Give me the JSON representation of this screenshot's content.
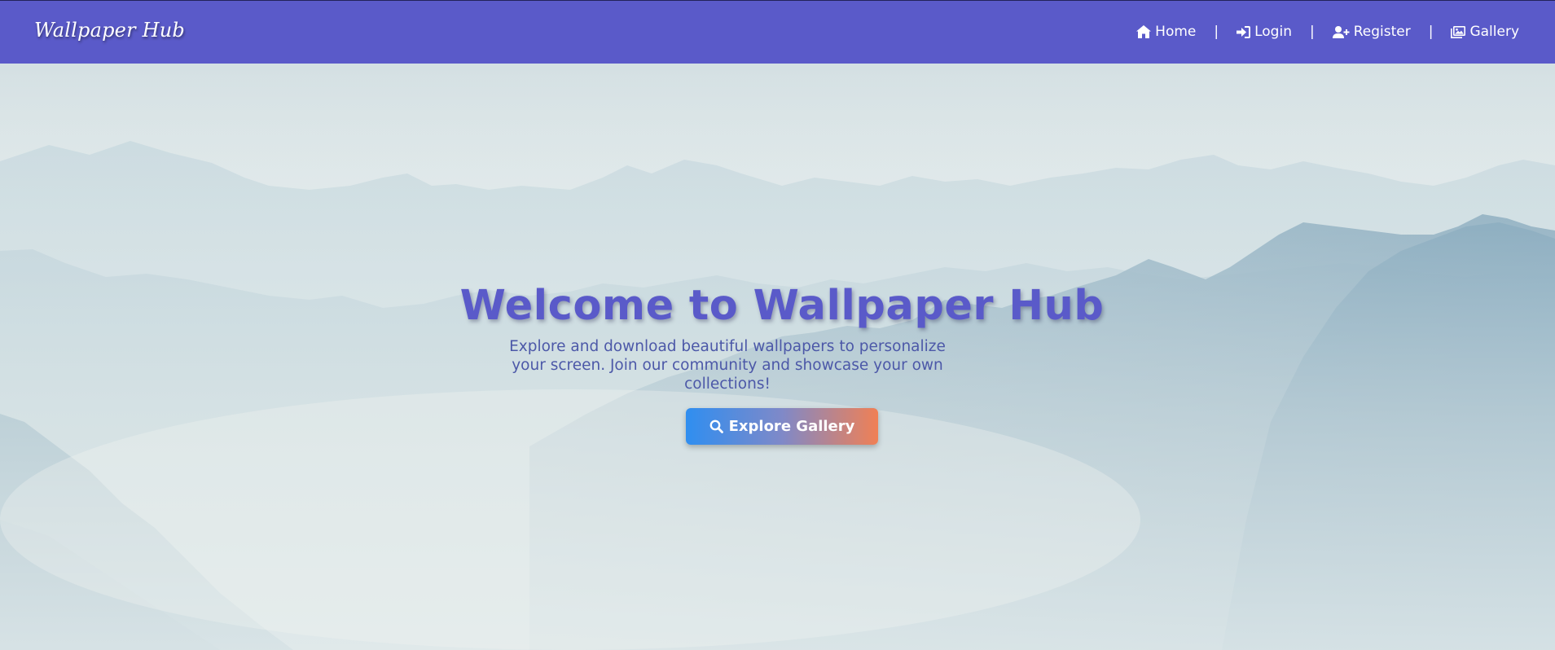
{
  "header": {
    "logo": "Wallpaper Hub",
    "nav": [
      {
        "label": "Home",
        "icon": "home-icon"
      },
      {
        "label": "Login",
        "icon": "sign-in-icon"
      },
      {
        "label": "Register",
        "icon": "user-plus-icon"
      },
      {
        "label": "Gallery",
        "icon": "images-icon"
      }
    ],
    "separator": "|"
  },
  "hero": {
    "title": "Welcome to Wallpaper Hub",
    "subtitle": "Explore and download beautiful wallpapers to personalize your screen. Join our community and showcase your own collections!",
    "button_label": "Explore Gallery",
    "button_icon": "search-icon"
  },
  "colors": {
    "navbar": "#5a5ac9",
    "title": "#5a5ac9",
    "subtitle": "#4c58a8",
    "button_gradient_start": "#2f8ef0",
    "button_gradient_end": "#f08055"
  }
}
